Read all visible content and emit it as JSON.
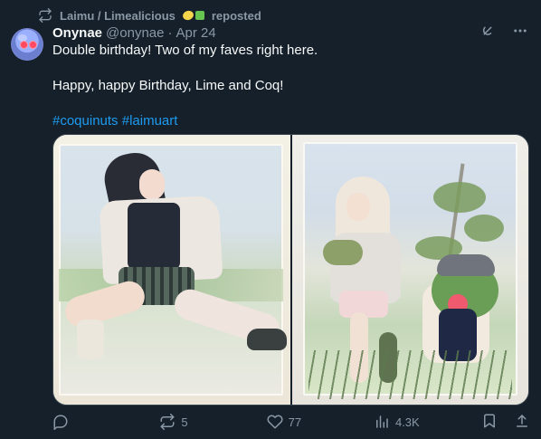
{
  "repost": {
    "label": "Laimu / Limealicious",
    "suffix": "reposted"
  },
  "author": {
    "name": "Onynae",
    "handle": "@onynae",
    "date": "Apr 24"
  },
  "tweet": {
    "line1": "Double birthday! Two of my faves right here.",
    "line2": "Happy, happy Birthday, Lime and Coq!",
    "hashtags": "#coquinuts #laimuart"
  },
  "metrics": {
    "retweets": "5",
    "likes": "77",
    "views": "4.3K"
  },
  "icons": {
    "repost": "repost-icon",
    "grok": "grok-icon",
    "more": "more-icon",
    "reply": "reply-icon",
    "retweet": "retweet-icon",
    "like": "heart-icon",
    "views": "analytics-icon",
    "bookmark": "bookmark-icon",
    "share": "share-icon"
  },
  "colors": {
    "background": "#15202b",
    "text": "#f7f9f9",
    "muted": "#8b98a5",
    "link": "#1d9bf0",
    "border": "#38444d"
  }
}
